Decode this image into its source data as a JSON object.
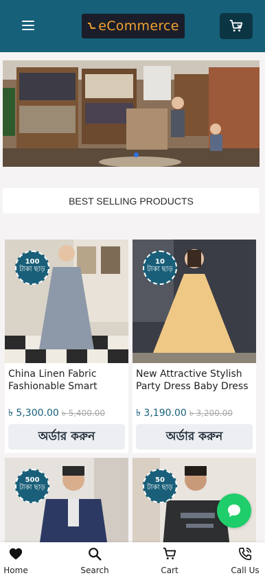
{
  "header": {
    "logo_text": "eCommerce",
    "menu_icon": "hamburger-icon",
    "cart_icon": "cart-icon"
  },
  "section": {
    "title": "BEST SELLING PRODUCTS"
  },
  "products": [
    {
      "badge_amount": "100",
      "badge_text": "টাকা ছাড়",
      "title": "China Linen Fabric Fashionable Smart Looking Gorgious",
      "price": "৳ 5,300.00",
      "old_price": "৳ 5,400.00",
      "order_label": "অর্ডার করুন"
    },
    {
      "badge_amount": "10",
      "badge_text": "টাকা ছাড়",
      "title": "New Attractive Stylish Party Dress Baby Dress for Girls",
      "price": "৳ 3,190.00",
      "old_price": "৳ 3,200.00",
      "order_label": "অর্ডার করুন"
    },
    {
      "badge_amount": "500",
      "badge_text": "টাকা ছাড়"
    },
    {
      "badge_amount": "50",
      "badge_text": "টাকা ছাড়"
    }
  ],
  "nav": {
    "home": "Home",
    "search": "Search",
    "cart": "Cart",
    "call": "Call Us"
  },
  "colors": {
    "brand": "#16607a",
    "logo_accent": "#f2a12f",
    "chat": "#1fce6a"
  }
}
